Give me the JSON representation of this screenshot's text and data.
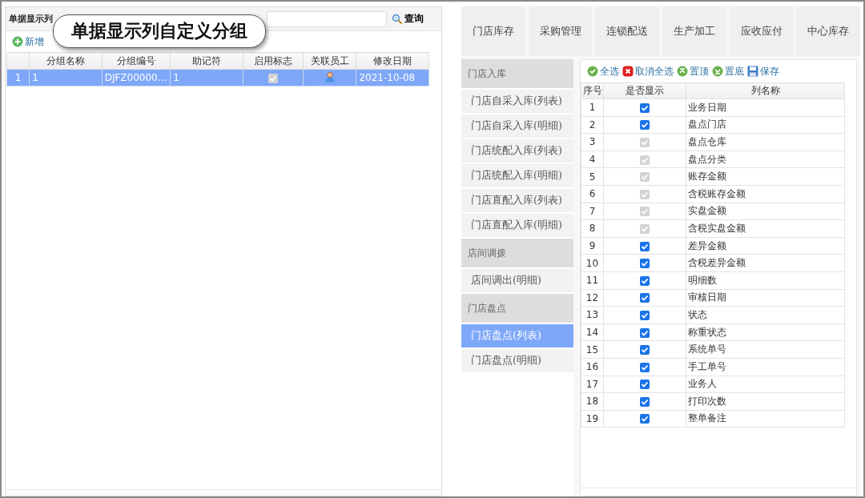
{
  "left_panel": {
    "title": "单据显示列",
    "search_button": "查询",
    "toolbar": [
      {
        "kind": "add",
        "label": "新增"
      }
    ],
    "table": {
      "columns": [
        "",
        "分组名称",
        "分组编号",
        "助记符",
        "启用标志",
        "关联员工",
        "修改日期"
      ],
      "rows": [
        {
          "selected": true,
          "index": "1",
          "name": "1",
          "code": "DJFZ00000…",
          "mnemonic": "1",
          "enabled": true,
          "date": "2021-10-08"
        }
      ]
    }
  },
  "callout": "单据显示列自定义分组",
  "tabs": [
    {
      "label": "门店库存",
      "selected": false
    },
    {
      "label": "采购管理",
      "selected": false
    },
    {
      "label": "连锁配送",
      "selected": false
    },
    {
      "label": "生产加工",
      "selected": false
    },
    {
      "label": "应收应付",
      "selected": false
    },
    {
      "label": "中心库存",
      "selected": false
    }
  ],
  "sidebar": {
    "items": [
      {
        "kind": "group",
        "label": "门店入库"
      },
      {
        "kind": "item",
        "label": "门店自采入库(列表)",
        "selected": false
      },
      {
        "kind": "item",
        "label": "门店自采入库(明细)",
        "selected": false
      },
      {
        "kind": "item",
        "label": "门店统配入库(列表)",
        "selected": false
      },
      {
        "kind": "item",
        "label": "门店统配入库(明细)",
        "selected": false
      },
      {
        "kind": "item",
        "label": "门店直配入库(列表)",
        "selected": false
      },
      {
        "kind": "item",
        "label": "门店直配入库(明细)",
        "selected": false
      },
      {
        "kind": "group",
        "label": "店间调拨"
      },
      {
        "kind": "item",
        "label": "店间调出(明细)",
        "selected": false
      },
      {
        "kind": "group",
        "label": "门店盘点"
      },
      {
        "kind": "item",
        "label": "门店盘点(列表)",
        "selected": true
      },
      {
        "kind": "item",
        "label": "门店盘点(明细)",
        "selected": false
      }
    ]
  },
  "column_grid": {
    "toolbar": [
      {
        "kind": "select_all",
        "label": "全选"
      },
      {
        "kind": "deselect_all",
        "label": "取消全选"
      },
      {
        "kind": "top",
        "label": "置顶"
      },
      {
        "kind": "bottom",
        "label": "置底"
      },
      {
        "kind": "save",
        "label": "保存"
      }
    ],
    "columns": [
      "序号",
      "是否显示",
      "列名称"
    ],
    "rows": [
      {
        "index": "1",
        "checked": true,
        "disabled": false,
        "name": "业务日期"
      },
      {
        "index": "2",
        "checked": true,
        "disabled": false,
        "name": "盘点门店"
      },
      {
        "index": "3",
        "checked": true,
        "disabled": true,
        "name": "盘点仓库"
      },
      {
        "index": "4",
        "checked": true,
        "disabled": true,
        "name": "盘点分类"
      },
      {
        "index": "5",
        "checked": true,
        "disabled": true,
        "name": "账存金额"
      },
      {
        "index": "6",
        "checked": true,
        "disabled": true,
        "name": "含税账存金额"
      },
      {
        "index": "7",
        "checked": true,
        "disabled": true,
        "name": "实盘金额"
      },
      {
        "index": "8",
        "checked": true,
        "disabled": true,
        "name": "含税实盘金额"
      },
      {
        "index": "9",
        "checked": true,
        "disabled": false,
        "name": "差异金额"
      },
      {
        "index": "10",
        "checked": true,
        "disabled": false,
        "name": "含税差异金额"
      },
      {
        "index": "11",
        "checked": true,
        "disabled": false,
        "name": "明细数"
      },
      {
        "index": "12",
        "checked": true,
        "disabled": false,
        "name": "审核日期"
      },
      {
        "index": "13",
        "checked": true,
        "disabled": false,
        "name": "状态"
      },
      {
        "index": "14",
        "checked": true,
        "disabled": false,
        "name": "称重状态"
      },
      {
        "index": "15",
        "checked": true,
        "disabled": false,
        "name": "系统单号"
      },
      {
        "index": "16",
        "checked": true,
        "disabled": false,
        "name": "手工单号"
      },
      {
        "index": "17",
        "checked": true,
        "disabled": false,
        "name": "业务人"
      },
      {
        "index": "18",
        "checked": true,
        "disabled": false,
        "name": "打印次数"
      },
      {
        "index": "19",
        "checked": true,
        "disabled": false,
        "name": "整单备注"
      }
    ]
  }
}
